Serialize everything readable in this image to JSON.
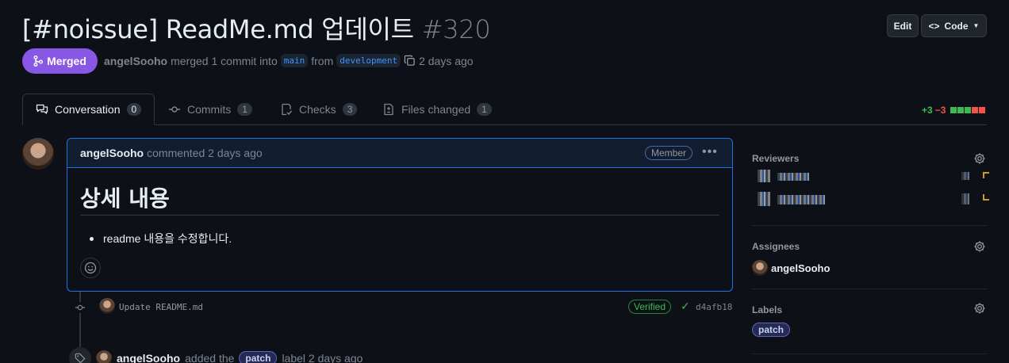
{
  "title": {
    "text": "[#noissue] ReadMe.md 업데이트",
    "number": "#320"
  },
  "header_buttons": {
    "edit": "Edit",
    "code": "Code"
  },
  "meta": {
    "status": "Merged",
    "author": "angelSooho",
    "text1": "merged 1 commit into",
    "base_branch": "main",
    "text2": "from",
    "head_branch": "development",
    "time": "2 days ago"
  },
  "tabs": [
    {
      "label": "Conversation",
      "count": "0"
    },
    {
      "label": "Commits",
      "count": "1"
    },
    {
      "label": "Checks",
      "count": "3"
    },
    {
      "label": "Files changed",
      "count": "1"
    }
  ],
  "diffstat": {
    "additions": "+3",
    "deletions": "−3"
  },
  "comment": {
    "author": "angelSooho",
    "action": "commented 2 days ago",
    "role": "Member",
    "heading": "상세 내용",
    "bullet": "readme 내용을 수정합니다."
  },
  "commit": {
    "message": "Update README.md",
    "verified": "Verified",
    "sha": "d4afb18"
  },
  "label_event": {
    "author": "angelSooho",
    "text1": "added the",
    "label": "patch",
    "text2": "label 2 days ago"
  },
  "sidebar": {
    "reviewers_title": "Reviewers",
    "assignees_title": "Assignees",
    "assignee": "angelSooho",
    "labels_title": "Labels",
    "label": "patch"
  },
  "colors": {
    "merged": "#8957e5",
    "accent": "#1f6feb",
    "success": "#3fb950",
    "danger": "#f85149"
  }
}
